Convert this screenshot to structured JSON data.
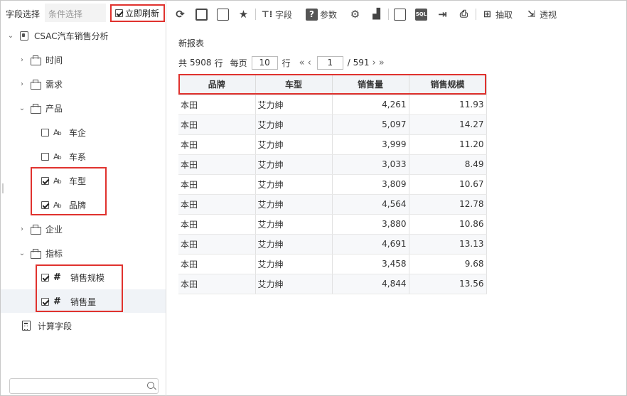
{
  "left_panel": {
    "tabs": {
      "fields": "字段选择",
      "conditions": "条件选择"
    },
    "instant_refresh": {
      "label": "立即刷新",
      "checked": true
    },
    "tree": {
      "root": "CSAC汽车销售分析",
      "time": "时间",
      "demand": "需求",
      "product": "产品",
      "car_company": "车企",
      "car_series": "车系",
      "car_model": "车型",
      "brand": "品牌",
      "enterprise": "企业",
      "metrics": "指标",
      "sales_scale": "销售规模",
      "sales_volume": "销售量",
      "calc_field": "计算字段"
    },
    "search": {
      "placeholder": ""
    }
  },
  "toolbar": {
    "field": "字段",
    "param": "参数",
    "extract": "抽取",
    "pivot": "透视",
    "sql": "SQL"
  },
  "report": {
    "title": "新报表",
    "total_prefix": "共",
    "total": "5908",
    "row_unit": "行",
    "per_page_label": "每页",
    "per_page": "10",
    "per_page_unit": "行",
    "current_page": "1",
    "total_pages": "/ 591",
    "columns": [
      "品牌",
      "车型",
      "销售量",
      "销售规模"
    ],
    "rows": [
      [
        "本田",
        "艾力绅",
        "4,261",
        "11.93"
      ],
      [
        "本田",
        "艾力绅",
        "5,097",
        "14.27"
      ],
      [
        "本田",
        "艾力绅",
        "3,999",
        "11.20"
      ],
      [
        "本田",
        "艾力绅",
        "3,033",
        "8.49"
      ],
      [
        "本田",
        "艾力绅",
        "3,809",
        "10.67"
      ],
      [
        "本田",
        "艾力绅",
        "4,564",
        "12.78"
      ],
      [
        "本田",
        "艾力绅",
        "3,880",
        "10.86"
      ],
      [
        "本田",
        "艾力绅",
        "4,691",
        "13.13"
      ],
      [
        "本田",
        "艾力绅",
        "3,458",
        "9.68"
      ],
      [
        "本田",
        "艾力绅",
        "4,844",
        "13.56"
      ]
    ]
  },
  "colors": {
    "highlight_red": "#e0322e"
  }
}
